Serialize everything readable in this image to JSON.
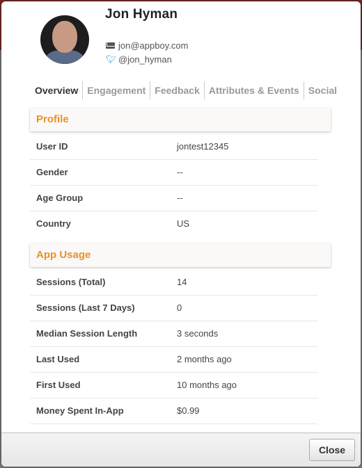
{
  "user": {
    "name": "Jon Hyman",
    "email": "jon@appboy.com",
    "twitter": "@jon_hyman"
  },
  "tabs": [
    {
      "label": "Overview",
      "active": true
    },
    {
      "label": "Engagement",
      "active": false
    },
    {
      "label": "Feedback",
      "active": false
    },
    {
      "label": "Attributes & Events",
      "active": false
    },
    {
      "label": "Social",
      "active": false
    }
  ],
  "profile": {
    "title": "Profile",
    "rows": [
      {
        "key": "User ID",
        "value": "jontest12345"
      },
      {
        "key": "Gender",
        "value": "--"
      },
      {
        "key": "Age Group",
        "value": "--"
      },
      {
        "key": "Country",
        "value": "US"
      }
    ]
  },
  "app_usage": {
    "title": "App Usage",
    "rows": [
      {
        "key": "Sessions (Total)",
        "value": "14"
      },
      {
        "key": "Sessions (Last 7 Days)",
        "value": "0"
      },
      {
        "key": "Median Session Length",
        "value": "3 seconds"
      },
      {
        "key": "Last Used",
        "value": "2 months ago"
      },
      {
        "key": "First Used",
        "value": "10 months ago"
      },
      {
        "key": "Money Spent In-App",
        "value": "$0.99"
      }
    ]
  },
  "footer": {
    "close_label": "Close"
  },
  "colors": {
    "accent": "#e8912a",
    "twitter": "#38a1d8"
  }
}
